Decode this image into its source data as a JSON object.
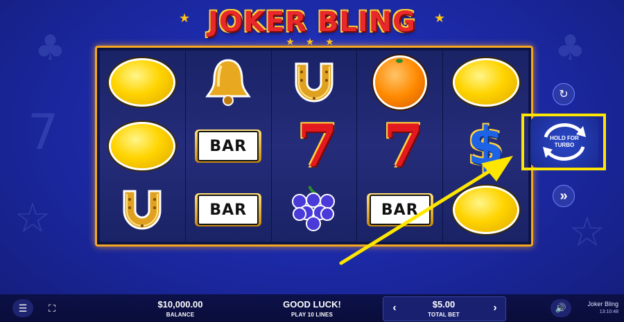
{
  "game": {
    "title": "JOKER BLING",
    "stars": "★ ★ ★",
    "side_star": "★"
  },
  "reels": [
    [
      "lemon",
      "lemon",
      "horseshoe"
    ],
    [
      "bell",
      "bar",
      "bar"
    ],
    [
      "horseshoe",
      "seven",
      "grapes"
    ],
    [
      "orange",
      "seven",
      "bar"
    ],
    [
      "lemon",
      "dollar",
      "lemon"
    ]
  ],
  "symbols": {
    "bar_text": "BAR",
    "seven_text": "7",
    "dollar_text": "$"
  },
  "controls": {
    "autoplay_icon": "↻",
    "turbo_label": "HOLD FOR TURBO",
    "fast_forward_icon": "»"
  },
  "bottom_bar": {
    "menu_icon": "☰",
    "fullscreen_icon": "⛶",
    "balance_value": "$10,000.00",
    "balance_label": "BALANCE",
    "status_text": "GOOD LUCK!",
    "lines_label": "PLAY 10 LINES",
    "bet_decrease": "‹",
    "bet_value": "$5.00",
    "bet_label": "TOTAL BET",
    "bet_increase": "›",
    "sound_icon": "🔊",
    "game_name": "Joker Bling",
    "clock": "13:10:48"
  },
  "colors": {
    "background": "#1c2aa8",
    "frame": "#f5a623",
    "highlight": "#ffe600",
    "title_red": "#e8282a"
  }
}
